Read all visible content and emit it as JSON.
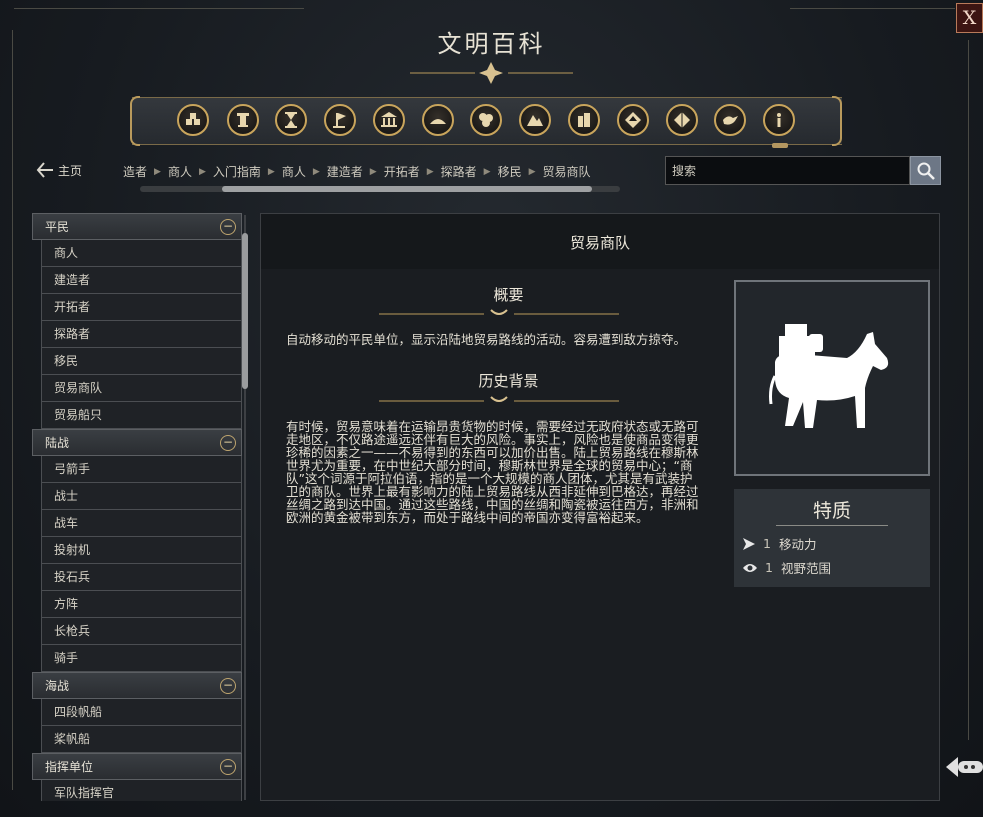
{
  "window": {
    "title": "文明百科",
    "close_label": "X"
  },
  "categories": [
    {
      "icon": "civilizations-icon"
    },
    {
      "icon": "wonder-icon"
    },
    {
      "icon": "hourglass-icon"
    },
    {
      "icon": "flag-icon"
    },
    {
      "icon": "building-icon"
    },
    {
      "icon": "terrain-icon"
    },
    {
      "icon": "resources-icon"
    },
    {
      "icon": "mountain-icon"
    },
    {
      "icon": "city-icon"
    },
    {
      "icon": "diplomacy-icon"
    },
    {
      "icon": "pyramid-icon"
    },
    {
      "icon": "dove-icon"
    },
    {
      "icon": "info-icon",
      "selected": true
    }
  ],
  "nav": {
    "home_label": "主页",
    "breadcrumb": [
      "造者",
      "商人",
      "入门指南",
      "商人",
      "建造者",
      "开拓者",
      "探路者",
      "移民",
      "贸易商队"
    ]
  },
  "search": {
    "placeholder": "搜索",
    "value": "搜索"
  },
  "sidebar": {
    "sections": [
      {
        "label": "平民",
        "toggle": "−",
        "items": [
          "商人",
          "建造者",
          "开拓者",
          "探路者",
          "移民",
          "贸易商队",
          "贸易船只"
        ]
      },
      {
        "label": "陆战",
        "toggle": "−",
        "items": [
          "弓箭手",
          "战士",
          "战车",
          "投射机",
          "投石兵",
          "方阵",
          "长枪兵",
          "骑手"
        ]
      },
      {
        "label": "海战",
        "toggle": "−",
        "items": [
          "四段帆船",
          "桨帆船"
        ]
      },
      {
        "label": "指挥单位",
        "toggle": "−",
        "items": [
          "军队指挥官"
        ]
      }
    ]
  },
  "article": {
    "title": "贸易商队",
    "overview_heading": "概要",
    "overview_text": "自动移动的平民单位，显示沿陆地贸易路线的活动。容易遭到敌方掠夺。",
    "history_heading": "历史背景",
    "history_text": "有时候，贸易意味着在运输昂贵货物的时候，需要经过无政府状态或无路可走地区，不仅路途遥远还伴有巨大的风险。事实上，风险也是使商品变得更珍稀的因素之一——不易得到的东西可以加价出售。陆上贸易路线在穆斯林世界尤为重要，在中世纪大部分时间，穆斯林世界是全球的贸易中心；“商队”这个词源于阿拉伯语，指的是一个大规模的商人团体，尤其是有武装护卫的商队。世界上最有影响力的陆上贸易路线从西非延伸到巴格达，再经过丝绸之路到达中国。通过这些路线，中国的丝绸和陶瓷被运往西方，非洲和欧洲的黄金被带到东方，而处于路线中间的帝国亦变得富裕起来。",
    "portrait_icon": "trade-caravan-donkey-icon"
  },
  "traits": {
    "title": "特质",
    "items": [
      {
        "icon": "movement-arrow-icon",
        "value": "1",
        "label": "移动力"
      },
      {
        "icon": "eye-icon",
        "value": "1",
        "label": "视野范围"
      }
    ]
  },
  "colors": {
    "gold": "#c9a55c",
    "panel": "#1a1d21",
    "close_bg": "#3c1512"
  }
}
